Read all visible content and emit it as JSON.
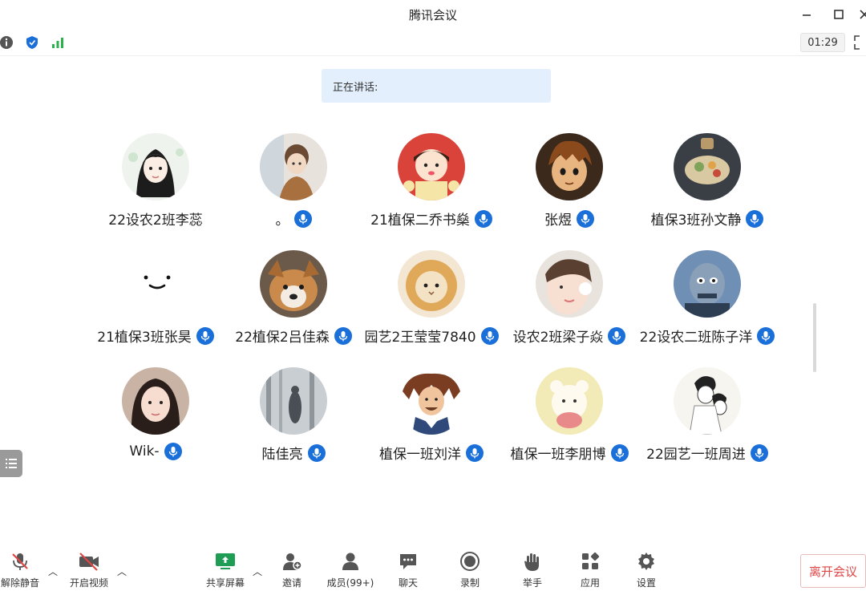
{
  "window": {
    "title": "腾讯会议"
  },
  "infobar": {
    "timer": "01:29"
  },
  "speaking": {
    "label": "正在讲话:"
  },
  "participants": [
    {
      "name": "22设农2班李蕊",
      "mic": false,
      "avatar": "girl-braids"
    },
    {
      "name": "。",
      "mic": true,
      "avatar": "boy-photo"
    },
    {
      "name": "21植保二乔书燊",
      "mic": true,
      "avatar": "cartoon-girl-red"
    },
    {
      "name": "张煜",
      "mic": true,
      "avatar": "anime-boy"
    },
    {
      "name": "植保3班孙文静",
      "mic": true,
      "avatar": "food-photo"
    },
    {
      "name": "21植保3班张昊",
      "mic": true,
      "avatar": "smiley-face"
    },
    {
      "name": "22植保2吕佳森",
      "mic": true,
      "avatar": "dog-photo"
    },
    {
      "name": "园艺2王莹莹7840",
      "mic": true,
      "avatar": "cat-lion"
    },
    {
      "name": "设农2班梁子焱",
      "mic": true,
      "avatar": "girl-selfie"
    },
    {
      "name": "22设农二班陈子洋",
      "mic": true,
      "avatar": "cartoon-man-blue"
    },
    {
      "name": "Wik-",
      "mic": true,
      "avatar": "girl-portrait"
    },
    {
      "name": "陆佳亮",
      "mic": true,
      "avatar": "forest-figure"
    },
    {
      "name": "植保一班刘洋",
      "mic": true,
      "avatar": "cartoon-man-sailor"
    },
    {
      "name": "植保一班李朋博",
      "mic": true,
      "avatar": "bear-cartoon"
    },
    {
      "name": "22园艺一班周进",
      "mic": true,
      "avatar": "sketch-couple"
    }
  ],
  "toolbar": {
    "unmute": "解除静音",
    "start_video": "开启视频",
    "share_screen": "共享屏幕",
    "invite": "邀请",
    "members": "成员(99+)",
    "chat": "聊天",
    "record": "录制",
    "raise_hand": "举手",
    "apps": "应用",
    "settings": "设置",
    "leave": "离开会议"
  },
  "colors": {
    "accent": "#1a6fd9",
    "leave": "#e04646",
    "share": "#1f9d55",
    "speaking_bg": "#e3effd"
  }
}
